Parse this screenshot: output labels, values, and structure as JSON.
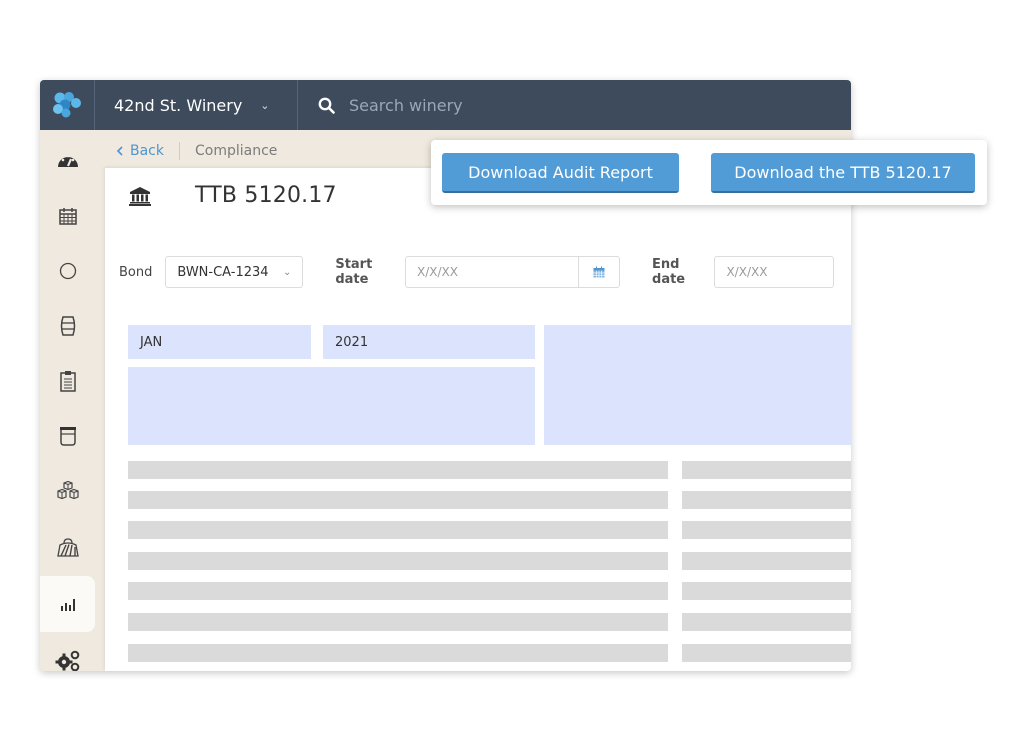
{
  "topbar": {
    "account_name": "42nd St. Winery",
    "search_placeholder": "Search winery"
  },
  "breadcrumb": {
    "back_label": "Back",
    "current": "Compliance"
  },
  "sidebar": {
    "items": [
      {
        "icon": "dashboard-gauge-icon",
        "active": false
      },
      {
        "icon": "calendar-icon",
        "active": false
      },
      {
        "icon": "circle-icon",
        "active": false
      },
      {
        "icon": "barrel-icon",
        "active": false
      },
      {
        "icon": "clipboard-icon",
        "active": false
      },
      {
        "icon": "tank-icon",
        "active": false
      },
      {
        "icon": "boxes-icon",
        "active": false
      },
      {
        "icon": "vineyard-icon",
        "active": false
      },
      {
        "icon": "reports-chart-icon",
        "active": true
      },
      {
        "icon": "settings-gears-icon",
        "active": false
      }
    ]
  },
  "page": {
    "title": "TTB 5120.17",
    "title_icon": "bank-building-icon"
  },
  "filters": {
    "bond_label": "Bond",
    "bond_value": "BWN-CA-1234",
    "start_date_label": "Start date",
    "start_date_placeholder": "X/X/XX",
    "end_date_label": "End date",
    "end_date_placeholder": "X/X/XX"
  },
  "period": {
    "month": "JAN",
    "year": "2021"
  },
  "actions": {
    "download_audit": "Download Audit Report",
    "download_ttb": "Download the TTB 5120.17"
  },
  "colors": {
    "topbar": "#3d4b5c",
    "sidebar": "#efe9df",
    "accent": "#519bd6",
    "highlight": "#dce4fd",
    "placeholder_row": "#dadada"
  }
}
